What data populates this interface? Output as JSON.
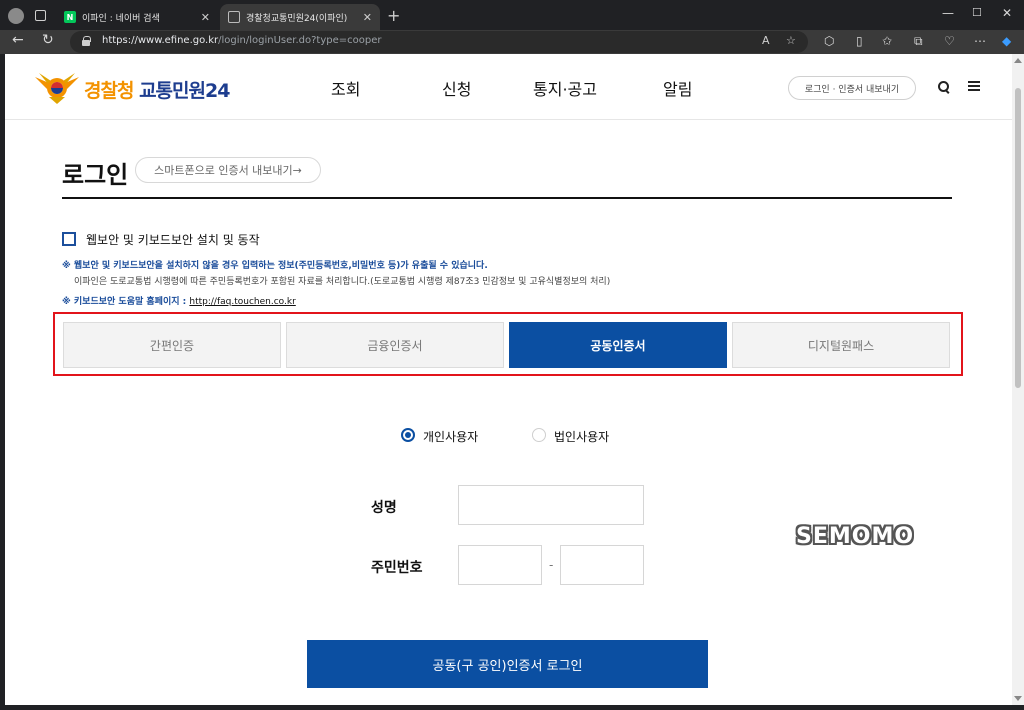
{
  "browser": {
    "tabs": [
      {
        "title": "이파인 : 네이버 검색",
        "favicon": "N"
      },
      {
        "title": "경찰청교통민원24(이파인)"
      }
    ],
    "url_domain": "https://www.efine.go.kr",
    "url_path": "/login/loginUser.do?type=cooper",
    "reader_label": "A"
  },
  "header": {
    "logo_part1": "경찰청",
    "logo_part2": "교통민원24",
    "nav": [
      "조회",
      "신청",
      "통지·공고",
      "알림"
    ],
    "login_export": "로그인 · 인증서 내보내기"
  },
  "login": {
    "title": "로그인",
    "smartphone_export": "스마트폰으로 인증서 내보내기→",
    "security_checkbox": "웹보안 및 키보드보안 설치 및 동작",
    "notice1": "※ 웹보안 및 키보드보안을 설치하지 않을 경우 입력하는 정보(주민등록번호,비밀번호 등)가 유출될 수 있습니다.",
    "notice2": "이파인은 도로교통법 시행령에 따른 주민등록번호가 포함된 자료를 처리합니다.(도로교통법 시행령 제87조3 민감정보 및 고유식별정보의 처리)",
    "notice3_label": "※ 키보드보안 도움말 홈페이지 : ",
    "notice3_link": "http://faq.touchen.co.kr",
    "cert_tabs": [
      "간편인증",
      "금융인증서",
      "공동인증서",
      "디지털원패스"
    ],
    "active_tab": "공동인증서",
    "user_types": [
      "개인사용자",
      "법인사용자"
    ],
    "selected_user_type": "개인사용자",
    "name_label": "성명",
    "name_value": "",
    "rrn_label": "주민번호",
    "rrn_front": "",
    "rrn_back": "",
    "rrn_separator": "-",
    "submit_label": "공동(구 공인)인증서 로그인"
  },
  "watermark": "SEMOMO",
  "colors": {
    "primary": "#0b4fa2",
    "highlight_border": "#e2141b",
    "logo_orange": "#f39200",
    "logo_navy": "#1d3d8f"
  }
}
